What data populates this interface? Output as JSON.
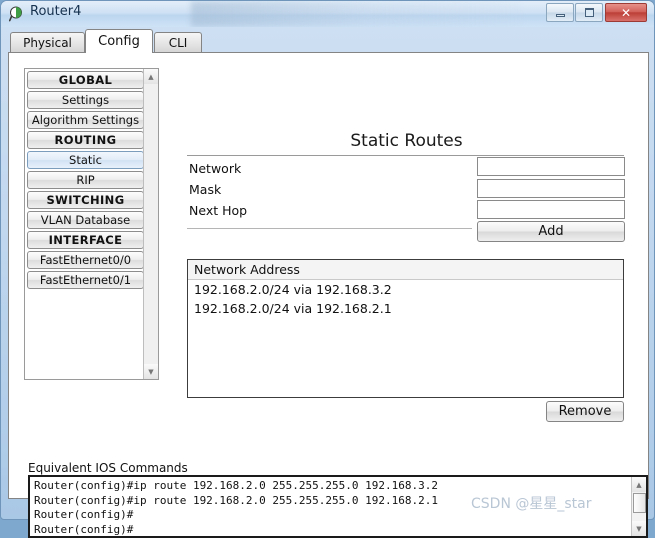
{
  "window": {
    "title": "Router4",
    "icon": "packet-tracer-router-icon",
    "controls": {
      "minimize": "Minimize",
      "maximize": "Maximize",
      "close": "Close",
      "close_glyph": "✕"
    }
  },
  "tabs": [
    {
      "label": "Physical",
      "active": false
    },
    {
      "label": "Config",
      "active": true
    },
    {
      "label": "CLI",
      "active": false
    }
  ],
  "sidebar": {
    "items": [
      {
        "label": "GLOBAL",
        "type": "header",
        "selected": false
      },
      {
        "label": "Settings",
        "type": "item",
        "selected": false
      },
      {
        "label": "Algorithm Settings",
        "type": "item",
        "selected": false
      },
      {
        "label": "ROUTING",
        "type": "header",
        "selected": false
      },
      {
        "label": "Static",
        "type": "item",
        "selected": true
      },
      {
        "label": "RIP",
        "type": "item",
        "selected": false
      },
      {
        "label": "SWITCHING",
        "type": "header",
        "selected": false
      },
      {
        "label": "VLAN Database",
        "type": "item",
        "selected": false
      },
      {
        "label": "INTERFACE",
        "type": "header",
        "selected": false
      },
      {
        "label": "FastEthernet0/0",
        "type": "item",
        "selected": false
      },
      {
        "label": "FastEthernet0/1",
        "type": "item",
        "selected": false
      }
    ],
    "scroll_up": "▲",
    "scroll_down": "▼"
  },
  "main": {
    "heading": "Static Routes",
    "form": {
      "network_label": "Network",
      "network_value": "",
      "network_placeholder": "",
      "mask_label": "Mask",
      "mask_value": "",
      "mask_placeholder": "",
      "nexthop_label": "Next Hop",
      "nexthop_value": "",
      "nexthop_placeholder": "",
      "add_label": "Add"
    },
    "route_table": {
      "column_header": "Network Address",
      "rows": [
        "192.168.2.0/24 via 192.168.3.2",
        "192.168.2.0/24 via 192.168.2.1"
      ]
    },
    "remove_label": "Remove"
  },
  "ios": {
    "label": "Equivalent IOS Commands",
    "lines": [
      "Router(config)#ip route 192.168.2.0 255.255.255.0 192.168.3.2",
      "Router(config)#ip route 192.168.2.0 255.255.255.0 192.168.2.1",
      "Router(config)#",
      "Router(config)#"
    ],
    "scroll_up": "▲",
    "scroll_down": "▼"
  },
  "watermark": "CSDN @星星_star"
}
